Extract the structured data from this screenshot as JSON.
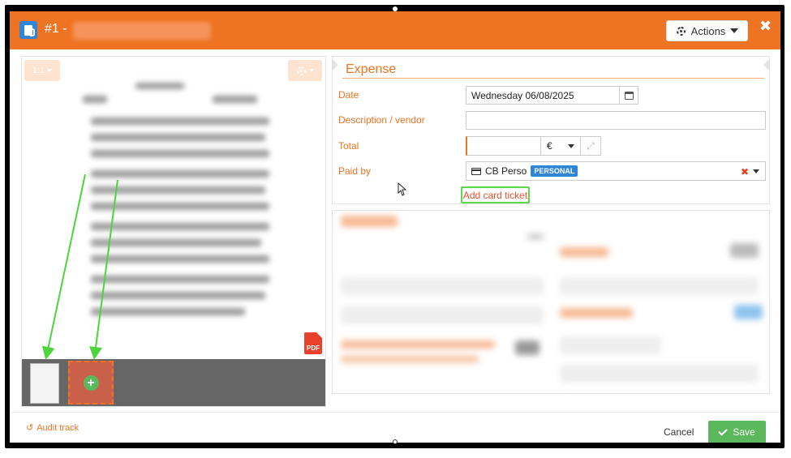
{
  "header": {
    "title": "#1 -",
    "actions_label": "Actions",
    "close_glyph": "✖"
  },
  "viewer": {
    "zoom_label": "1:1",
    "pdf_label": "PDF"
  },
  "expense": {
    "section_title": "Expense",
    "date_label": "Date",
    "date_value": "Wednesday 06/08/2025",
    "description_label": "Description / vendor",
    "description_value": "",
    "total_label": "Total",
    "total_value": "",
    "currency": "€",
    "paid_by_label": "Paid by",
    "paid_by_value": "CB Perso",
    "paid_by_badge": "PERSONAL",
    "add_card_ticket": "Add card ticket"
  },
  "footer": {
    "audit_label": "Audit track",
    "cancel_label": "Cancel",
    "save_label": "Save"
  },
  "colors": {
    "brand": "#ee7322",
    "accent_blue": "#2f86d6",
    "save_green": "#5cb85c",
    "highlight_green": "#5bd84b"
  }
}
